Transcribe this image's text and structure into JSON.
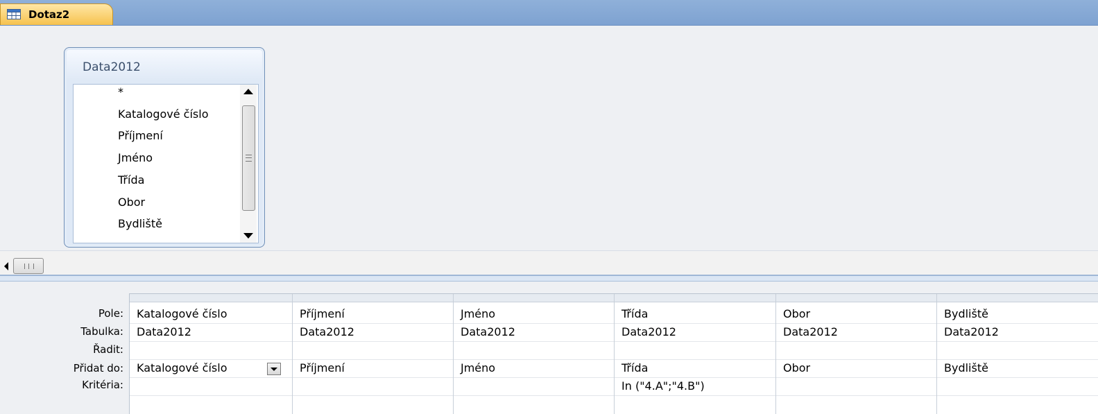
{
  "tab": {
    "title": "Dotaz2"
  },
  "table_box": {
    "title": "Data2012",
    "fields": [
      "*",
      "Katalogové číslo",
      "Příjmení",
      "Jméno",
      "Třída",
      "Obor",
      "Bydliště"
    ]
  },
  "grid": {
    "row_labels": {
      "field": "Pole:",
      "table": "Tabulka:",
      "sort": "Řadit:",
      "show": "Přidat do:",
      "criteria": "Kritéria:"
    },
    "columns": [
      {
        "field": "Katalogové číslo",
        "table": "Data2012",
        "sort": "",
        "show": "Katalogové číslo",
        "criteria": ""
      },
      {
        "field": "Příjmení",
        "table": "Data2012",
        "sort": "",
        "show": "Příjmení",
        "criteria": ""
      },
      {
        "field": "Jméno",
        "table": "Data2012",
        "sort": "",
        "show": "Jméno",
        "criteria": ""
      },
      {
        "field": "Třída",
        "table": "Data2012",
        "sort": "",
        "show": "Třída",
        "criteria": "In (\"4.A\";\"4.B\")"
      },
      {
        "field": "Obor",
        "table": "Data2012",
        "sort": "",
        "show": "Obor",
        "criteria": ""
      },
      {
        "field": "Bydliště",
        "table": "Data2012",
        "sort": "",
        "show": "Bydliště",
        "criteria": ""
      }
    ]
  },
  "icons": {
    "tab_icon": "query-table-icon",
    "scroll_up": "chevron-up-icon",
    "scroll_down": "chevron-down-icon",
    "scroll_left": "chevron-left-icon",
    "dropdown": "dropdown-arrow-icon"
  },
  "colors": {
    "tab_active": "#f6c24e",
    "tabbar": "#7ea2d1"
  }
}
